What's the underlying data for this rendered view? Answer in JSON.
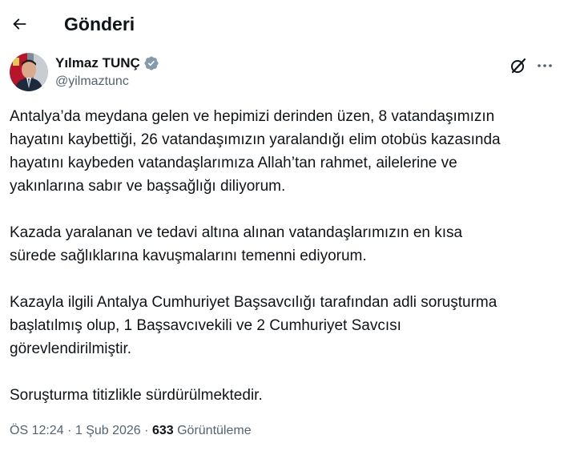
{
  "header": {
    "title": "Gönderi",
    "back_icon": "arrow-left-icon"
  },
  "author": {
    "name": "Yılmaz TUNÇ",
    "handle": "@yilmaztunc",
    "verified_icon": "verified-badge-icon",
    "verified_color": "#829aab"
  },
  "actions": {
    "grok_icon": "grok-icon",
    "more_icon": "more-horizontal-icon"
  },
  "tweet": {
    "paragraphs": [
      {
        "lines": [
          "Antalya’da meydana gelen ve hepimizi derinden üzen, 8 vatandaşımızın",
          "hayatını kaybettiği, 26 vatandaşımızın yaralandığı elim otobüs kazasında",
          "hayatını kaybeden vatandaşlarımıza Allah’tan rahmet, ailelerine ve",
          "yakınlarına sabır ve başsağlığı diliyorum."
        ]
      },
      {
        "lines": [
          "Kazada yaralanan ve tedavi altına alınan vatandaşlarımızın en kısa",
          "sürede sağlıklarına kavuşmalarını temenni ediyorum."
        ]
      },
      {
        "lines": [
          "Kazayla ilgili Antalya Cumhuriyet Başsavcılığı tarafından adli soruşturma",
          "başlatılmış olup, 1 Başsavcıvekili ve 2 Cumhuriyet Savcısı",
          "görevlendirilmiştir."
        ]
      },
      {
        "lines": [
          "Soruşturma titizlikle sürdürülmektedir."
        ]
      }
    ]
  },
  "meta": {
    "time": "ÖS 12:24",
    "separator": "·",
    "date": "1 Şub 2026",
    "views_count": "633",
    "views_label": "Görüntüleme"
  },
  "colors": {
    "text": "#0f1419",
    "secondary": "#536471"
  }
}
